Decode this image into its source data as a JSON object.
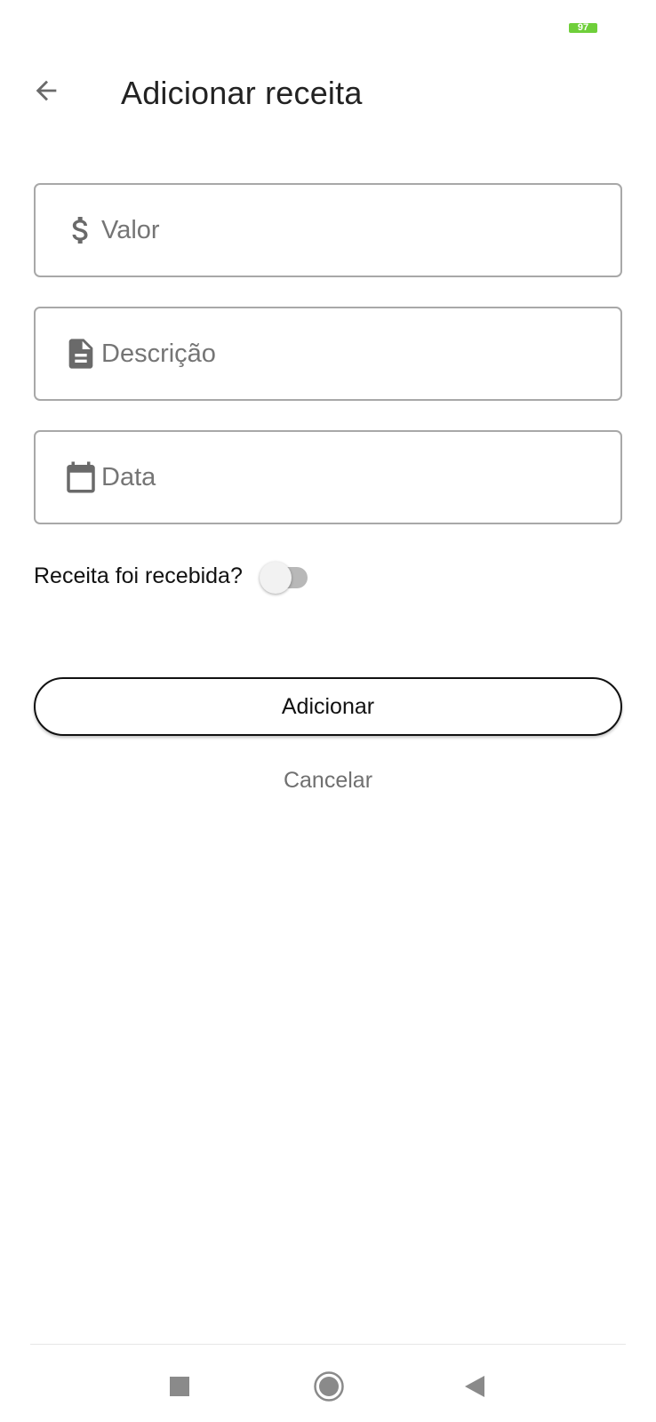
{
  "status_bar": {
    "battery_level": "97",
    "battery_color": "#6fcf3a"
  },
  "header": {
    "back_icon": "arrow-left-icon",
    "title": "Adicionar receita"
  },
  "form": {
    "valor": {
      "icon": "dollar-sign-icon",
      "placeholder": "Valor",
      "value": ""
    },
    "descricao": {
      "icon": "document-icon",
      "placeholder": "Descrição",
      "value": ""
    },
    "data": {
      "icon": "calendar-icon",
      "placeholder": "Data",
      "value": ""
    },
    "received_toggle": {
      "label": "Receita foi recebida?",
      "checked": false
    }
  },
  "actions": {
    "add_label": "Adicionar",
    "cancel_label": "Cancelar"
  },
  "nav_bar": {
    "recents_icon": "square-icon",
    "home_icon": "circle-icon",
    "back_icon": "triangle-back-icon"
  },
  "colors": {
    "icon_gray": "#757575",
    "border_gray": "#a8a8a8",
    "text_dark": "#222222"
  }
}
